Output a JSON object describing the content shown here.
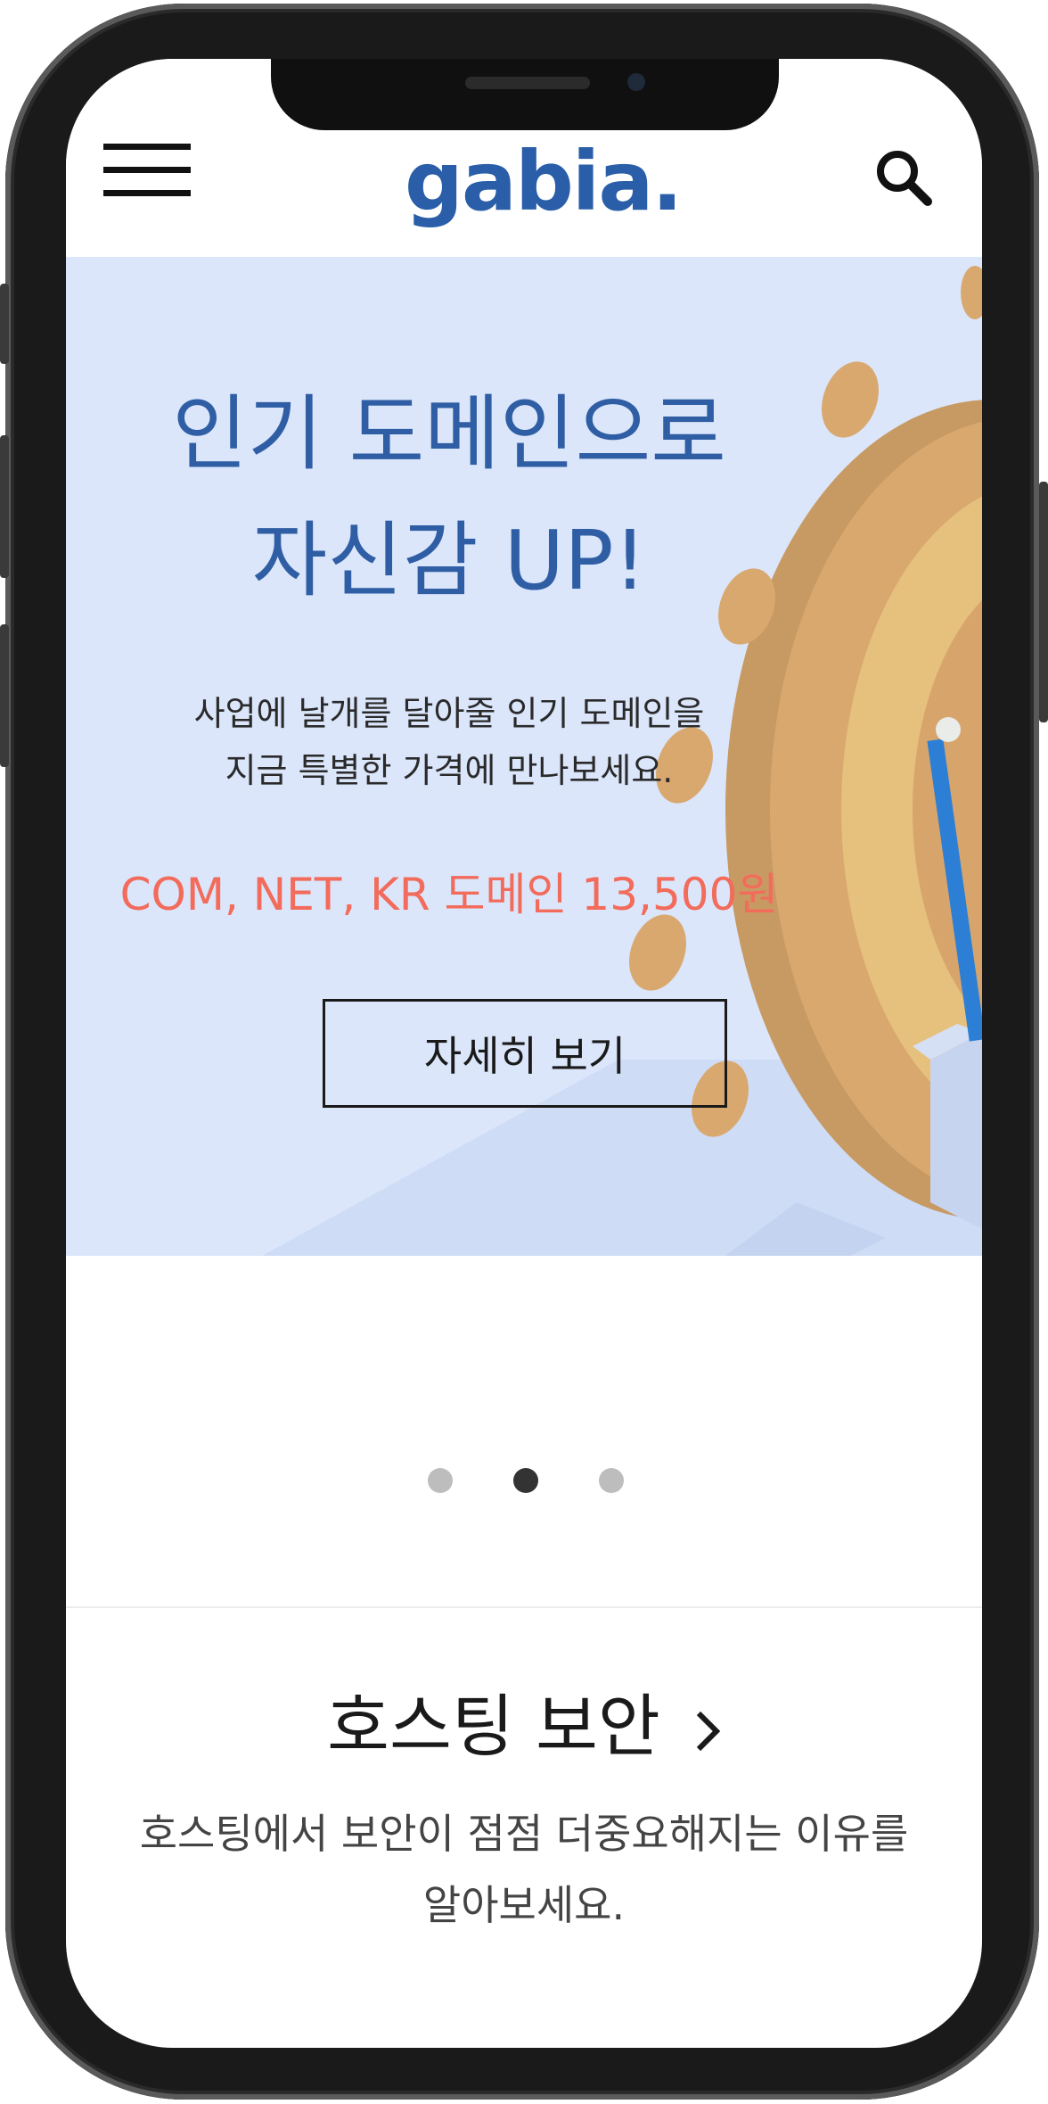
{
  "header": {
    "logo_text": "gabia."
  },
  "banner": {
    "title_line1": "인기 도메인으로",
    "title_line2": "자신감 UP!",
    "desc_line1": "사업에 날개를 달아줄 인기 도메인을",
    "desc_line2": "지금 특별한 가격에 만나보세요.",
    "price": "COM, NET, KR 도메인 13,500원",
    "button_label": "자세히 보기"
  },
  "pagination": {
    "total": 3,
    "active_index": 1
  },
  "section": {
    "title": "호스팅 보안",
    "desc_line1": "호스팅에서 보안이 점점 더중요해지는 이유를",
    "desc_line2": "알아보세요."
  },
  "colors": {
    "banner_bg": "#dbe6fb",
    "title_blue": "#2f5ea4",
    "price_red": "#f26b5b",
    "logo_blue": "#2a5ea8"
  },
  "icons": [
    "hamburger-menu-icon",
    "search-icon",
    "chevron-right-icon"
  ]
}
